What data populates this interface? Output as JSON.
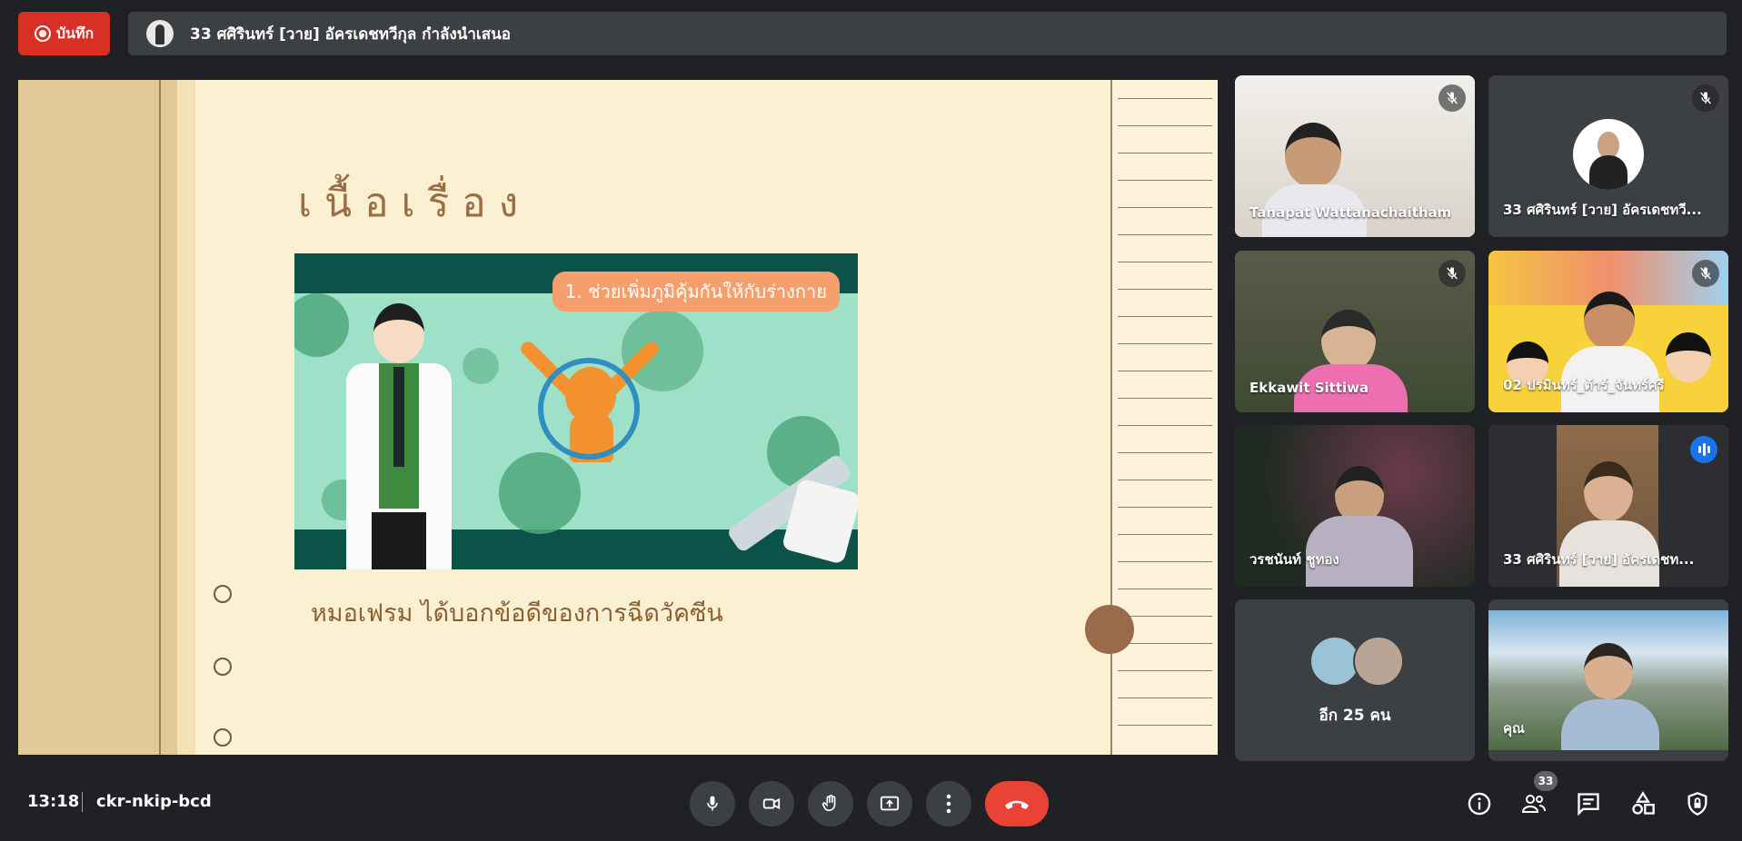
{
  "recording": {
    "label": "บันทึก"
  },
  "presenter_banner": {
    "text": "33 ศศิรินทร์ [วาย] อัครเดชทวีกุล กำลังนำเสนอ"
  },
  "slide": {
    "title": "เนื้อเรื่อง",
    "image_banner": "1. ช่วยเพิ่มภูมิคุ้มกันให้กับร่างกาย",
    "caption": "หมอเฟรม ได้บอกข้อดีของการฉีดวัคซีน"
  },
  "participants": [
    {
      "name": "Tanapat Wattanachaitham",
      "muted": true
    },
    {
      "name": "33 ศศิรินทร์ [วาย] อัครเดชทวี...",
      "muted": true
    },
    {
      "name": "Ekkawit Sittiwa",
      "muted": true
    },
    {
      "name": "02 ปรมินทร์_ต้าร์_จันทร์ศรี",
      "muted": true
    },
    {
      "name": "วรชนันท์ ชูทอง",
      "muted": false
    },
    {
      "name": "33 ศศิรินทร์ [วาย] อัครเดชท...",
      "speaking": true
    },
    {
      "name": "อีก 25 คน"
    },
    {
      "name": "คุณ"
    }
  ],
  "bottom_bar": {
    "time": "13:18",
    "meeting_code": "ckr-nkip-bcd",
    "participant_count": "33"
  },
  "colors": {
    "background": "#202124",
    "end_call": "#ea4335",
    "record": "#d93025",
    "speaking": "#1a73e8"
  }
}
